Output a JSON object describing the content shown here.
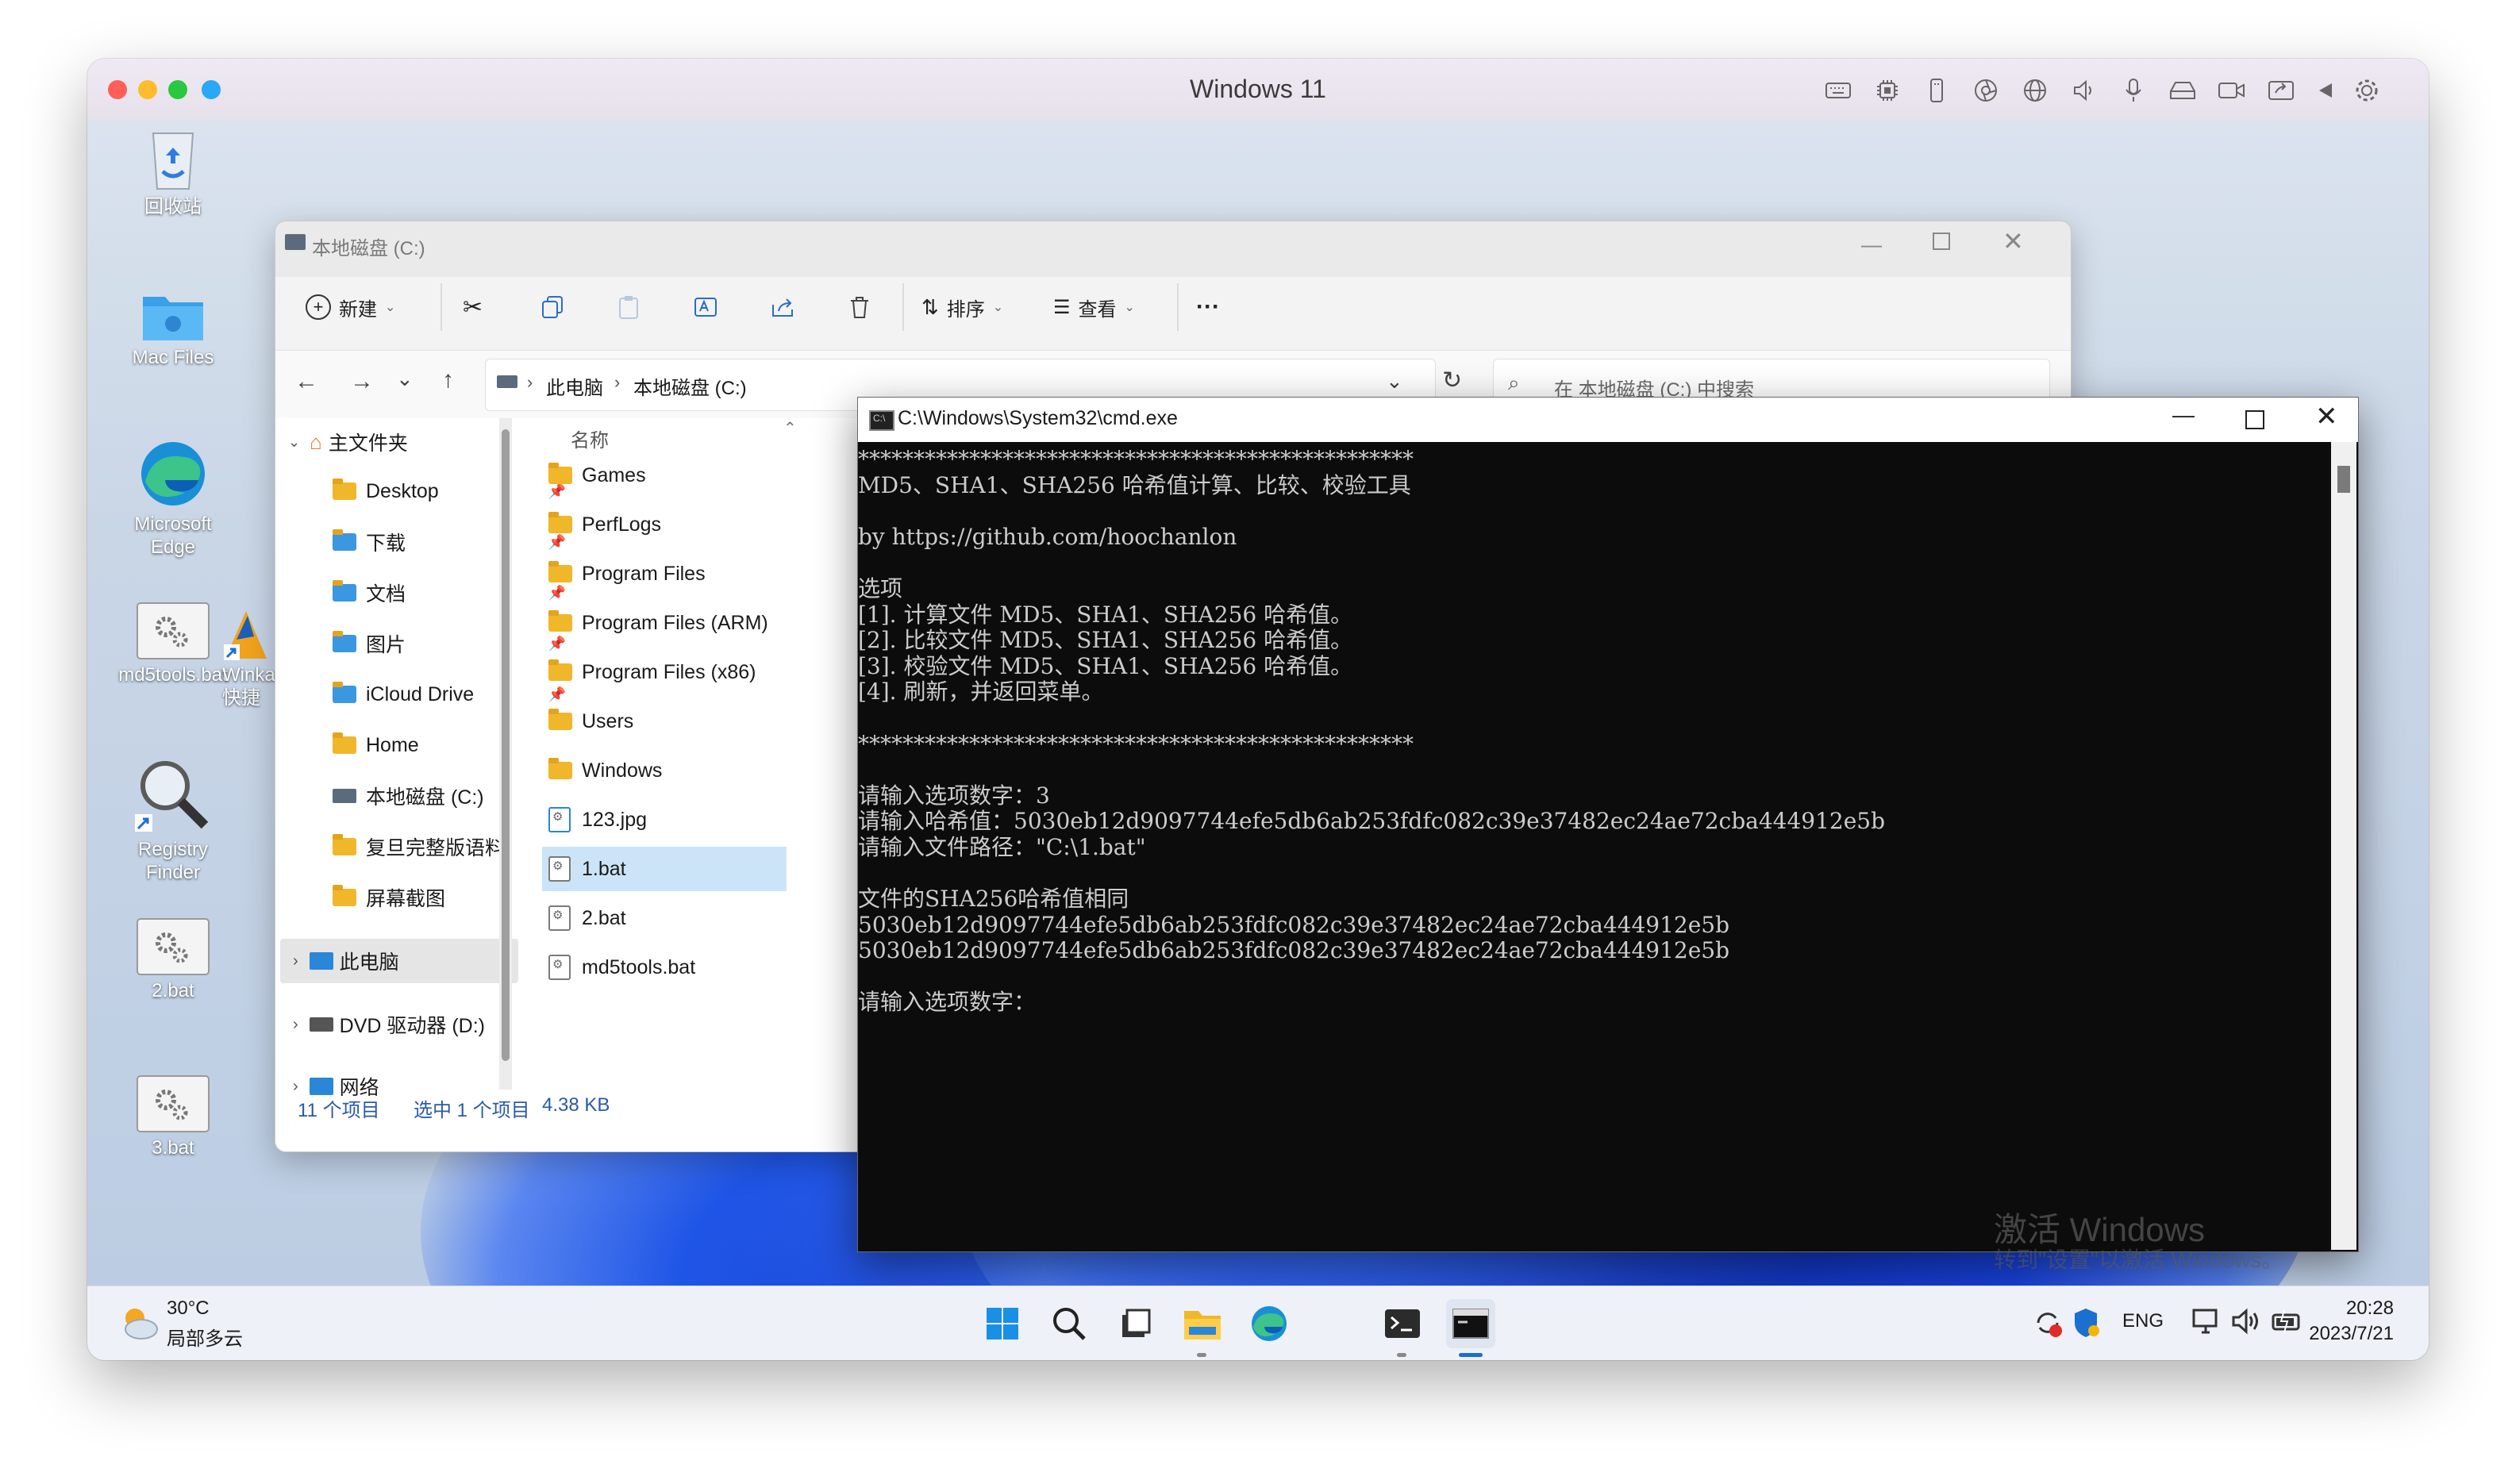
{
  "vm_window": {
    "title": "Windows 11",
    "traffic_lights": [
      "#ff5f57",
      "#febc2e",
      "#28c840",
      "#2aa7f5"
    ],
    "toolbar_icons": [
      "keyboard-icon",
      "cpu-icon",
      "usb-icon",
      "camera-aperture-icon",
      "globe-icon",
      "speaker-icon",
      "microphone-icon",
      "disk-icon",
      "video-icon",
      "share-screen-icon",
      "play-back-icon",
      "gear-icon"
    ]
  },
  "desktop_icons": [
    {
      "label": "回收站",
      "icon": "recycle-bin-icon"
    },
    {
      "label": "Mac Files",
      "icon": "mac-folder-icon"
    },
    {
      "label": "Microsoft Edge",
      "icon": "edge-icon"
    },
    {
      "label": "md5tools.bat",
      "icon": "bat-file-icon"
    },
    {
      "label": "Winkav 快捷",
      "icon": "shortcut-icon"
    },
    {
      "label": "Registry Finder",
      "icon": "magnifier-icon"
    },
    {
      "label": "2.bat",
      "icon": "bat-file-icon"
    },
    {
      "label": "3.bat",
      "icon": "bat-file-icon"
    }
  ],
  "explorer": {
    "title": "本地磁盘 (C:)",
    "toolbar": {
      "new_label": "新建",
      "sort_label": "排序",
      "view_label": "查看",
      "more_label": "···"
    },
    "breadcrumb": [
      "此电脑",
      "本地磁盘 (C:)"
    ],
    "search_placeholder": "在 本地磁盘 (C:) 中搜索",
    "nav": {
      "home_label": "主文件夹",
      "items": [
        "Desktop",
        "下载",
        "文档",
        "图片",
        "iCloud Drive",
        "Home",
        "本地磁盘 (C:)",
        "复旦完整版语料",
        "屏幕截图"
      ],
      "this_pc_label": "此电脑",
      "dvd_label": "DVD 驱动器 (D:)",
      "network_label": "网络"
    },
    "column_name": "名称",
    "files": [
      {
        "name": "Games",
        "type": "folder"
      },
      {
        "name": "PerfLogs",
        "type": "folder"
      },
      {
        "name": "Program Files",
        "type": "folder"
      },
      {
        "name": "Program Files (ARM)",
        "type": "folder"
      },
      {
        "name": "Program Files (x86)",
        "type": "folder"
      },
      {
        "name": "Users",
        "type": "folder"
      },
      {
        "name": "Windows",
        "type": "folder"
      },
      {
        "name": "123.jpg",
        "type": "image"
      },
      {
        "name": "1.bat",
        "type": "bat",
        "selected": true
      },
      {
        "name": "2.bat",
        "type": "bat"
      },
      {
        "name": "md5tools.bat",
        "type": "bat"
      }
    ],
    "status": {
      "count": "11 个项目",
      "selection": "选中 1 个项目",
      "size": "4.38 KB"
    }
  },
  "cmd": {
    "title": "C:\\Windows\\System32\\cmd.exe",
    "lines": [
      "**************************************************",
      "MD5、SHA1、SHA256 哈希值计算、比较、校验工具",
      "",
      "by https://github.com/hoochanlon",
      "",
      "选项",
      "[1]. 计算文件 MD5、SHA1、SHA256 哈希值。",
      "[2]. 比较文件 MD5、SHA1、SHA256 哈希值。",
      "[3]. 校验文件 MD5、SHA1、SHA256 哈希值。",
      "[4]. 刷新，并返回菜单。",
      "",
      "**************************************************",
      "",
      "请输入选项数字：3",
      "请输入哈希值：5030eb12d9097744efe5db6ab253fdfc082c39e37482ec24ae72cba444912e5b",
      "请输入文件路径：\"C:\\1.bat\"",
      "",
      "文件的SHA256哈希值相同",
      "5030eb12d9097744efe5db6ab253fdfc082c39e37482ec24ae72cba444912e5b",
      "5030eb12d9097744efe5db6ab253fdfc082c39e37482ec24ae72cba444912e5b",
      "",
      "请输入选项数字："
    ]
  },
  "watermark": {
    "line1": "激活 Windows",
    "line2": "转到\"设置\"以激活 Windows。"
  },
  "taskbar": {
    "weather_temp": "30°C",
    "weather_desc": "局部多云",
    "apps": [
      "start-icon",
      "search-icon",
      "task-view-icon",
      "file-explorer-icon",
      "edge-icon",
      "terminal-icon",
      "cmd-icon"
    ],
    "lang": "ENG",
    "time": "20:28",
    "date": "2023/7/21"
  }
}
